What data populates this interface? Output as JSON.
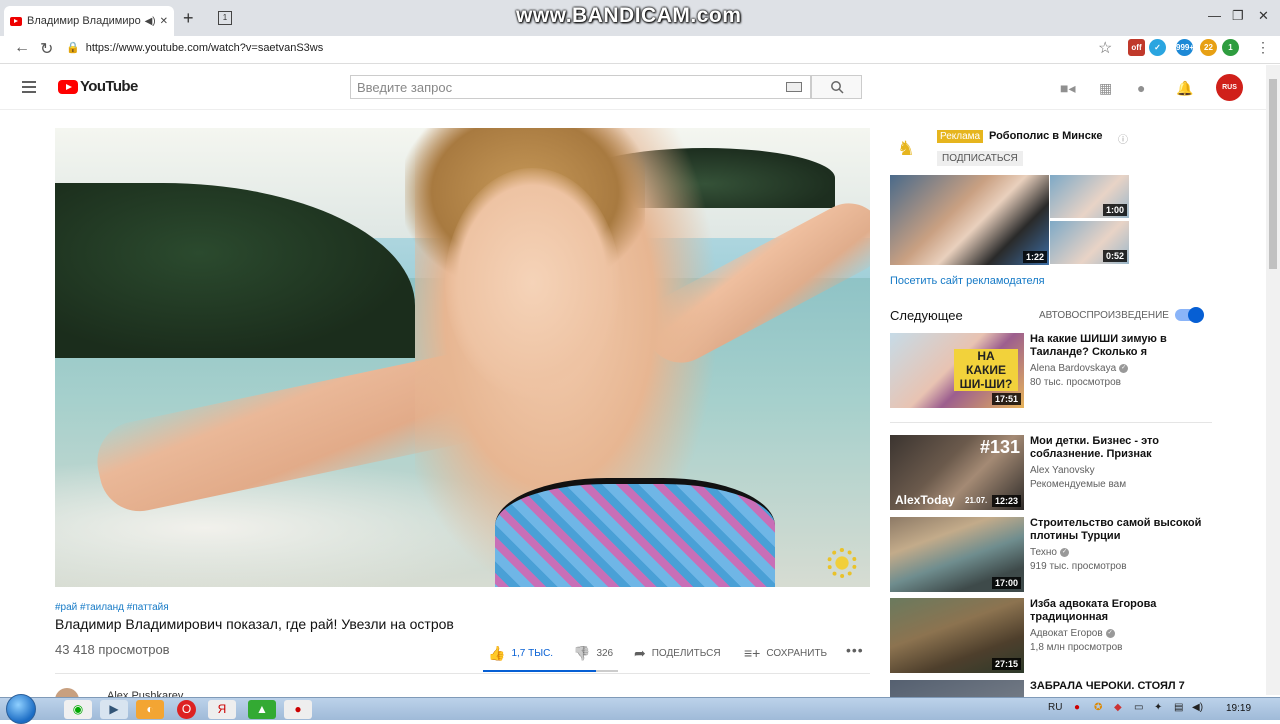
{
  "browser": {
    "tab_title": "Владимир Владимирови",
    "tab_count": "1",
    "watermark": "www.BANDICAM.com",
    "url": "https://www.youtube.com/watch?v=saetvanS3ws",
    "ext_badges": [
      "off",
      "999+",
      "22",
      "1"
    ]
  },
  "youtube": {
    "logo_text": "YouTube",
    "search_placeholder": "Введите запрос",
    "avatar_text": "RUS"
  },
  "video": {
    "tags": "#рай #таиланд #паттайя",
    "title": "Владимир Владимирович показал, где рай! Увезли на остров",
    "views": "43 418 просмотров",
    "likes": "1,7 ТЫС.",
    "dislikes": "326",
    "like_ratio": 0.84,
    "share": "ПОДЕЛИТЬСЯ",
    "save": "СОХРАНИТЬ",
    "channel_name": "Alex Pushkarev"
  },
  "sidebar": {
    "ad_badge": "Реклама",
    "ad_channel": "Робополис в Минске",
    "subscribe": "ПОДПИСАТЬСЯ",
    "ad_durations": [
      "1:22",
      "1:00",
      "0:52"
    ],
    "ad_link": "Посетить сайт рекламодателя",
    "next_label": "Следующее",
    "autoplay_label": "АВТОВОСПРОИЗВЕДЕНИЕ",
    "autoplay_on": true,
    "recommendations": [
      {
        "title": "На какие ШИШИ зимую в Таиланде? Сколько я",
        "channel": "Alena Bardovskaya",
        "meta": "80 тыс. просмотров",
        "duration": "17:51",
        "overlay": "НА КАКИЕ ШИ-ШИ?"
      },
      {
        "title": "Мои детки. Бизнес - это соблазнение. Признак",
        "channel": "Alex Yanovsky",
        "meta": "Рекомендуемые вам",
        "duration": "12:23",
        "overlay": "#131",
        "overlay2": "AlexToday",
        "overlay3": "21.07."
      },
      {
        "title": "Строительство самой высокой плотины Турции",
        "channel": "Техно",
        "meta": "919 тыс. просмотров",
        "duration": "17:00"
      },
      {
        "title": "Изба адвоката Егорова традиционная",
        "channel": "Адвокат Егоров",
        "meta": "1,8 млн просмотров",
        "duration": "27:15"
      },
      {
        "title": "ЗАБРАЛА ЧЕРОКИ. СТОЯЛ 7",
        "channel": "",
        "meta": "",
        "duration": ""
      }
    ]
  },
  "taskbar": {
    "lang": "RU",
    "time": "19:19"
  }
}
